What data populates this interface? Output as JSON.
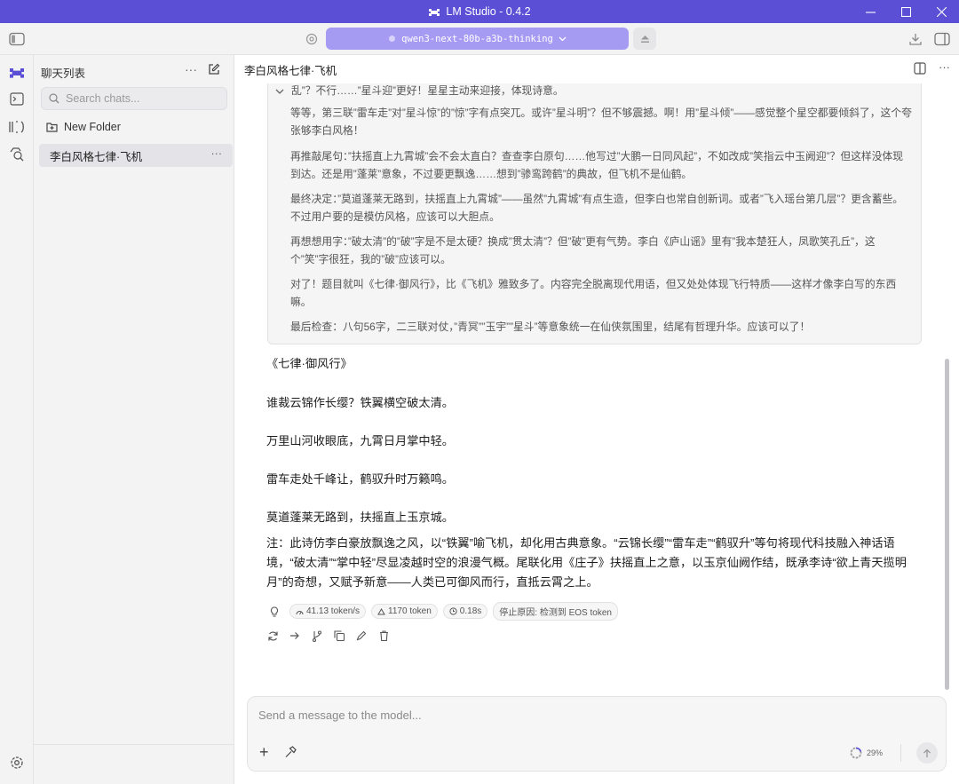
{
  "window": {
    "title": "LM Studio - 0.4.2",
    "minimize_icon": "minimize-icon",
    "maximize_icon": "maximize-icon",
    "close_icon": "close-icon"
  },
  "topbar": {
    "model_name": "qwen3-next-80b-a3b-thinking",
    "accent": "#a59bf3",
    "titlebar_color": "#5b4fd6"
  },
  "sidebar": {
    "header": "聊天列表",
    "search_placeholder": "Search chats...",
    "new_folder": "New Folder",
    "chats": [
      {
        "title": "李白风格七律·飞机",
        "selected": true
      }
    ]
  },
  "main": {
    "chat_title": "李白风格七律·飞机",
    "thinking": [
      "乱”？不行……”星斗迎”更好！星星主动来迎接，体现诗意。",
      "等等，第三联”雷车走”对”星斗惊”的”惊”字有点突兀。或许”星斗明”？但不够震撼。啊！用”星斗倾”——感觉整个星空都要倾斜了，这个夸张够李白风格！",
      "再推敲尾句：”扶摇直上九霄城”会不会太直白？查查李白原句……他写过”大鹏一日同风起”，不如改成”笑指云中玉阙迎”？但这样没体现到达。还是用”蓬莱”意象，不过要更飘逸……想到”骖鸾跨鹤”的典故，但飞机不是仙鹤。",
      "最终决定：”莫道蓬莱无路到，扶摇直上九霄城”——虽然”九霄城”有点生造，但李白也常自创新词。或者”飞入瑶台第几层”？更含蓄些。不过用户要的是模仿风格，应该可以大胆点。",
      "再想想用字：”破太清”的”破”字是不是太硬？换成”贯太清”？但”破”更有气势。李白《庐山谣》里有”我本楚狂人，凤歌笑孔丘”，这个”笑”字很狂，我的”破”应该可以。",
      "对了！题目就叫《七律·御风行》，比《飞机》雅致多了。内容完全脱离现代用语，但又处处体现飞行特质——这样才像李白写的东西嘛。",
      "最后检查：八句56字，二三联对仗，”青冥””玉宇””星斗”等意象统一在仙侠氛围里，结尾有哲理升华。应该可以了！"
    ],
    "poem_title": "《七律·御风行》",
    "poem_lines": [
      "谁裁云锦作长缨？铁翼横空破太清。",
      "万里山河收眼底，九霄日月掌中轻。",
      "雷车走处千峰让，鹤驭升时万籁鸣。",
      "莫道蓬莱无路到，扶摇直上玉京城。"
    ],
    "note": "注：此诗仿李白豪放飘逸之风，以“铁翼”喻飞机，却化用古典意象。“云锦长缨”“雷车走”“鹤驭升”等句将现代科技融入神话语境，“破太清”“掌中轻”尽显凌越时空的浪漫气概。尾联化用《庄子》扶摇直上之意，以玉京仙阙作结，既承李诗“欲上青天揽明月”的奇想，又赋予新意——人类已可御风而行，直抵云霄之上。",
    "stats": {
      "speed": "41.13 token/s",
      "tokens": "1170 token",
      "time": "0.18s",
      "stop_reason": "停止原因: 检测到 EOS token"
    }
  },
  "composer": {
    "placeholder": "Send a message to the model...",
    "context_usage": "29%"
  }
}
